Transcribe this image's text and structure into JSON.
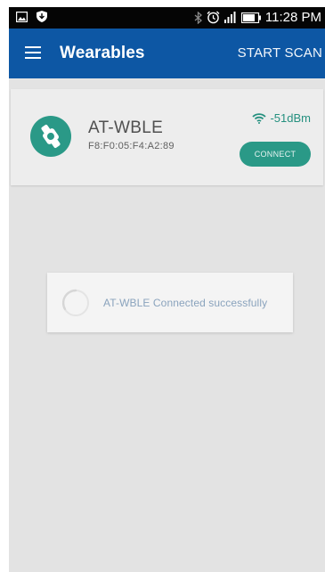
{
  "status_bar": {
    "time": "11:28 PM",
    "icons": [
      "image-icon",
      "shield-download-icon",
      "bluetooth-icon",
      "alarm-icon",
      "signal-icon",
      "battery-icon"
    ]
  },
  "app_bar": {
    "title": "Wearables",
    "action_label": "START SCAN",
    "menu_icon": "menu-icon",
    "color": "#0d57a4"
  },
  "device": {
    "name": "AT-WBLE",
    "mac": "F8:F0:05:F4:A2:89",
    "rssi": "-51dBm",
    "connect_label": "CONNECT",
    "icon": "watch-icon",
    "accent": "#2a9987"
  },
  "dialog": {
    "message": "AT-WBLE Connected successfully",
    "icon": "spinner-icon"
  }
}
